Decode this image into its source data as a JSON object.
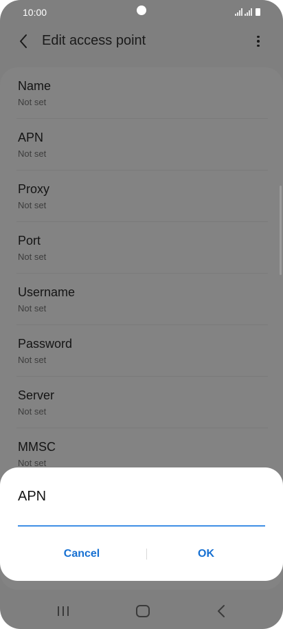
{
  "status_bar": {
    "time": "10:00"
  },
  "app_bar": {
    "title": "Edit access point",
    "back_icon": "chevron-left-icon",
    "more_icon": "more-vertical-icon"
  },
  "settings": [
    {
      "label": "Name",
      "value": "Not set"
    },
    {
      "label": "APN",
      "value": "Not set"
    },
    {
      "label": "Proxy",
      "value": "Not set"
    },
    {
      "label": "Port",
      "value": "Not set"
    },
    {
      "label": "Username",
      "value": "Not set"
    },
    {
      "label": "Password",
      "value": "Not set"
    },
    {
      "label": "Server",
      "value": "Not set"
    },
    {
      "label": "MMSC",
      "value": "Not set"
    }
  ],
  "dialog": {
    "title": "APN",
    "input_value": "",
    "cancel_label": "Cancel",
    "ok_label": "OK"
  },
  "colors": {
    "accent": "#1670d2",
    "input_underline": "#3e8ee5",
    "scrim_background": "#7f7f7f"
  }
}
